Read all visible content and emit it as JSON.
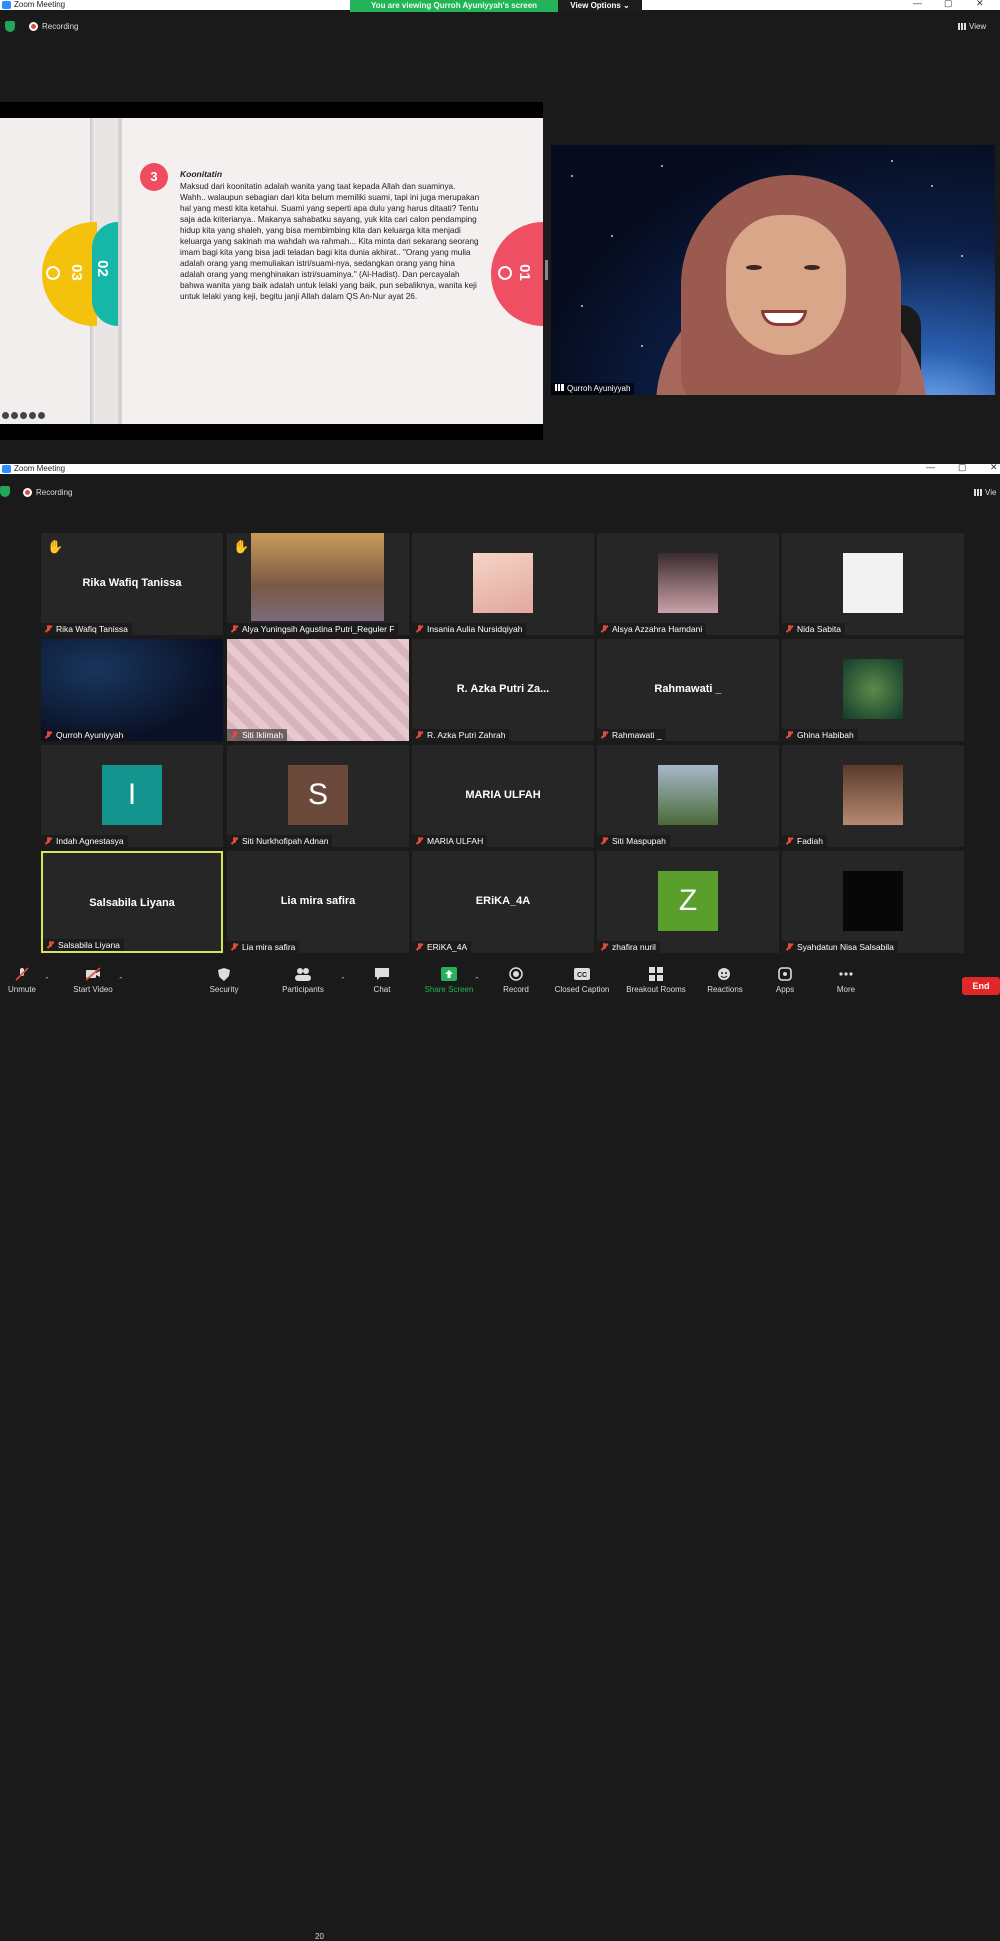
{
  "window1": {
    "title": "Zoom Meeting",
    "share_banner": "You are viewing Qurroh Ayuniyyah's screen",
    "view_options": "View Options ⌄",
    "recording_label": "Recording",
    "view_label": "View"
  },
  "slide": {
    "number": "3",
    "tab_labels": [
      "03",
      "02",
      "01"
    ],
    "title": "Koonitatin",
    "body": "Maksud dari koonitatin adalah wanita yang taat kepada Allah dan suaminya. Wahh.. walaupun sebagian dari kita belum memiliki suami, tapi ini juga merupakan hal yang mesti kita ketahui. Suami yang seperti apa dulu yang harus ditaati? Tentu saja ada kriterianya.. Makanya sahabatku sayang, yuk kita cari calon pendamping hidup kita yang shaleh, yang bisa membimbing kita dan keluarga kita menjadi keluarga yang sakinah ma wahdah wa rahmah... Kita minta dari sekarang seorang imam bagi kita yang bisa jadi teladan bagi kita dunia akhirat.. \"Orang yang mulia adalah orang yang memuliakan istri/suami-nya, sedangkan orang yang hina adalah orang yang menghinakan istri/suaminya.\" (Al-Hadist). Dan percayalah bahwa wanita yang baik adalah untuk lelaki yang baik, pun sebaliknya, wanita keji untuk lelaki yang keji, begitu janji Allah dalam QS An-Nur ayat 26."
  },
  "speaker": {
    "name": "Qurroh Ayuniyyah"
  },
  "window2": {
    "title": "Zoom Meeting",
    "recording_label": "Recording",
    "view_label": "Vie"
  },
  "participants": [
    {
      "name": "Rika Wafiq Tanissa",
      "center": "Rika Wafiq Tanissa",
      "hand": true
    },
    {
      "name": "Alya Yuningsih Agustina Putri_Reguler F",
      "center": "",
      "hand": true
    },
    {
      "name": "Insania Aulia Nursidqiyah",
      "center": ""
    },
    {
      "name": "Alsya Azzahra Hamdani",
      "center": ""
    },
    {
      "name": "Nida Sabita",
      "center": ""
    },
    {
      "name": "Qurroh Ayuniyyah",
      "center": ""
    },
    {
      "name": "Siti Iklimah",
      "center": ""
    },
    {
      "name": "R. Azka Putri Zahrah",
      "center": "R. Azka Putri Za..."
    },
    {
      "name": "Rahmawati _",
      "center": "Rahmawati _"
    },
    {
      "name": "Ghina Habibah",
      "center": ""
    },
    {
      "name": "Indah Agnestasya",
      "letter": "I",
      "color": "#13948e"
    },
    {
      "name": "Siti Nurkhofipah Adnan",
      "letter": "S",
      "color": "#6b4a3c"
    },
    {
      "name": "MARIA ULFAH",
      "center": "MARIA ULFAH"
    },
    {
      "name": "Siti Maspupah",
      "center": ""
    },
    {
      "name": "Fadiah",
      "center": ""
    },
    {
      "name": "Salsabila Liyana",
      "center": "Salsabila Liyana",
      "active": true
    },
    {
      "name": "Lia mira safira",
      "center": "Lia mira safira"
    },
    {
      "name": "ERiKA_4A",
      "center": "ERiKA_4A"
    },
    {
      "name": "zhafira nuril",
      "letter": "Z",
      "color": "#5a9e2c"
    },
    {
      "name": "Syahdatun Nisa Salsabila",
      "center": ""
    }
  ],
  "toolbar": {
    "unmute": "Unmute",
    "start_video": "Start Video",
    "security": "Security",
    "participants": "Participants",
    "participant_count": "20",
    "chat": "Chat",
    "share_screen": "Share Screen",
    "record": "Record",
    "closed_caption": "Closed Caption",
    "breakout_rooms": "Breakout Rooms",
    "reactions": "Reactions",
    "apps": "Apps",
    "more": "More",
    "end": "End"
  },
  "colors": {
    "share_green": "#24b35a",
    "end_red": "#e02828",
    "active_speaker": "#d8e45a",
    "slide_red": "#ef4f62",
    "slide_yellow": "#f4c20d",
    "slide_teal": "#15b8a8"
  }
}
